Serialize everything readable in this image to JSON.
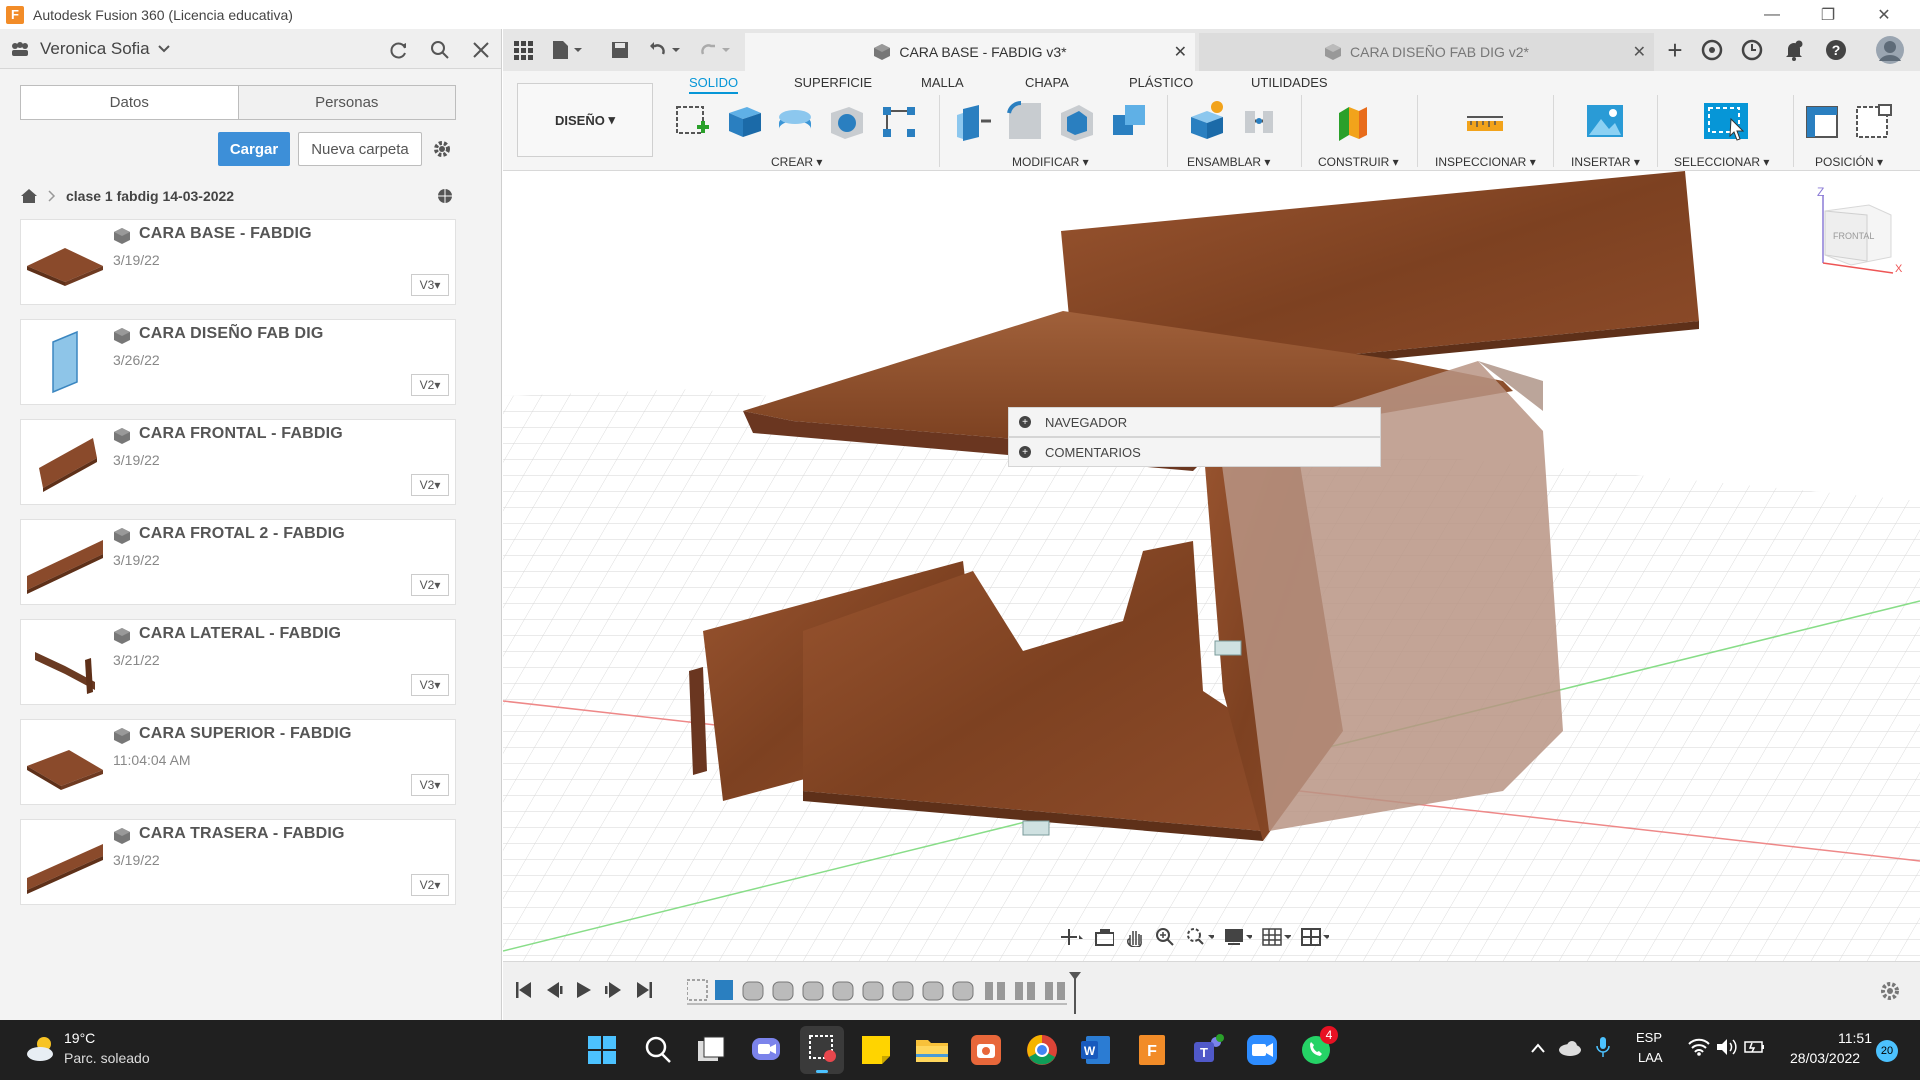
{
  "window": {
    "title": "Autodesk Fusion 360 (Licencia educativa)"
  },
  "user": {
    "name": "Veronica Sofia"
  },
  "left_tabs": [
    "Datos",
    "Personas"
  ],
  "buttons": {
    "upload": "Cargar",
    "new_folder": "Nueva carpeta"
  },
  "breadcrumb": "clase 1 fabdig 14-03-2022",
  "files": [
    {
      "name": "CARA BASE - FABDIG",
      "date": "3/19/22",
      "version": "V3"
    },
    {
      "name": "CARA DISEÑO FAB DIG",
      "date": "3/26/22",
      "version": "V2"
    },
    {
      "name": "CARA FRONTAL - FABDIG",
      "date": "3/19/22",
      "version": "V2"
    },
    {
      "name": "CARA FROTAL 2 - FABDIG",
      "date": "3/19/22",
      "version": "V2"
    },
    {
      "name": "CARA LATERAL - FABDIG",
      "date": "3/21/22",
      "version": "V3"
    },
    {
      "name": "CARA SUPERIOR - FABDIG",
      "date": "11:04:04 AM",
      "version": "V3"
    },
    {
      "name": "CARA TRASERA - FABDIG",
      "date": "3/19/22",
      "version": "V2"
    }
  ],
  "doc_tabs": {
    "active": "CARA BASE - FABDIG v3*",
    "inactive": "CARA DISEÑO FAB DIG v2*"
  },
  "workspace": "DISEÑO",
  "ribbon_tabs": [
    "SOLIDO",
    "SUPERFICIE",
    "MALLA",
    "CHAPA",
    "PLÁSTICO",
    "UTILIDADES"
  ],
  "ribbon_groups": [
    "CREAR",
    "MODIFICAR",
    "ENSAMBLAR",
    "CONSTRUIR",
    "INSPECCIONAR",
    "INSERTAR",
    "SELECCIONAR",
    "POSICIÓN"
  ],
  "panels": {
    "browser": "NAVEGADOR",
    "comments": "COMENTARIOS"
  },
  "viewcube": {
    "face": "FRONTAL",
    "axis_z": "Z",
    "axis_x": "X"
  },
  "taskbar": {
    "weather_temp": "19°C",
    "weather_desc": "Parc. soleado",
    "lang": "ESP",
    "lang_sub": "LAA",
    "time": "11:51",
    "date": "28/03/2022",
    "notif_count": "20",
    "whatsapp_badge": "4"
  },
  "colors": {
    "accent": "#0696d7",
    "upload": "#3d8fd8",
    "wood": "#8a4a2b"
  }
}
